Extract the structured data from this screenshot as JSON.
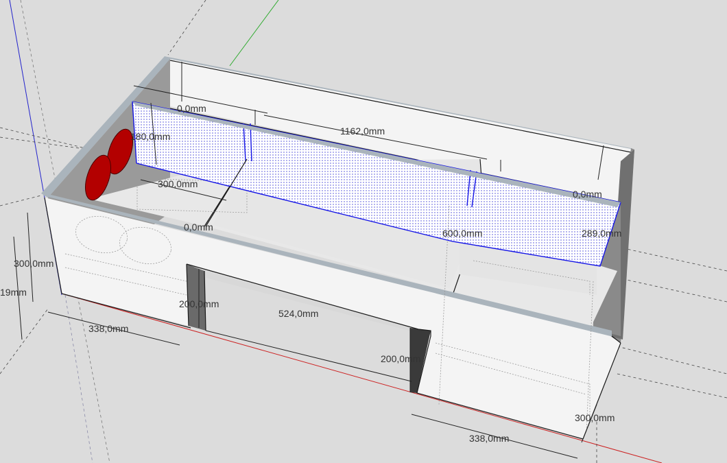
{
  "colors": {
    "background": "#dcdcdc",
    "panel_face": "#f4f4f4",
    "panel_shadow": "#8f8f8f",
    "panel_top": "#aab4bc",
    "selection_blue": "#1414e6",
    "speaker_red": "#b30000",
    "axis_red": "#cc2222",
    "axis_green": "#2eaa2e",
    "axis_blue": "#2222cc"
  },
  "dimensions": {
    "d_180": "180,0mm",
    "d_300_top": "300,0mm",
    "d_1162": "1162,0mm",
    "d_300_left": "300,0mm",
    "d_19": "19mm",
    "d_338_left": "338,0mm",
    "d_200_left": "200,0mm",
    "d_524": "524,0mm",
    "d_200_right": "200,0mm",
    "d_338_right": "338,0mm",
    "d_300_right": "300,0mm",
    "d_600": "600,0mm",
    "d_289": "289,0mm",
    "d_partial_top": "0,0mm",
    "d_partial_right": "0,0mm",
    "d_partial_mid": "0,0mm"
  }
}
